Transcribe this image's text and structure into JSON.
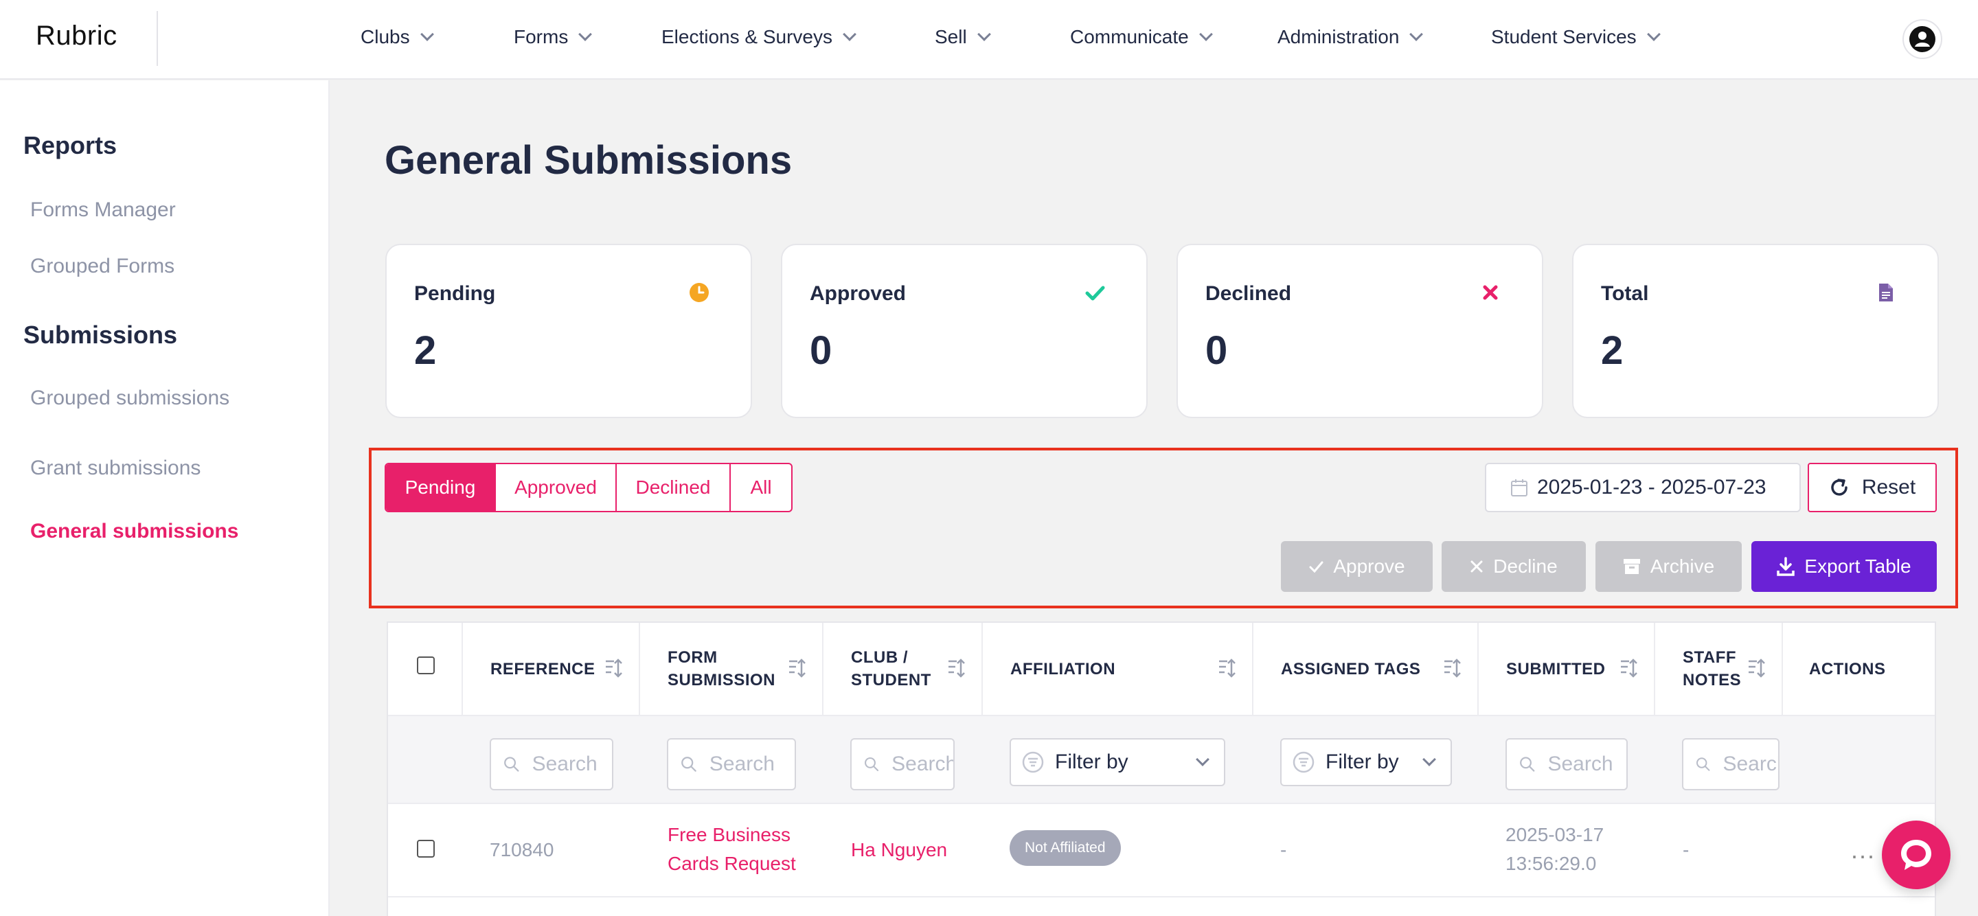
{
  "app": {
    "logo": "Rubric"
  },
  "nav": [
    {
      "label": "Clubs"
    },
    {
      "label": "Forms"
    },
    {
      "label": "Elections & Surveys"
    },
    {
      "label": "Sell"
    },
    {
      "label": "Communicate"
    },
    {
      "label": "Administration"
    },
    {
      "label": "Student Services"
    }
  ],
  "sidebar": {
    "reports_heading": "Reports",
    "reports_items": [
      {
        "label": "Forms Manager"
      },
      {
        "label": "Grouped Forms"
      }
    ],
    "submissions_heading": "Submissions",
    "submissions_items": [
      {
        "label": "Grouped submissions"
      },
      {
        "label": "Grant submissions"
      },
      {
        "label": "General submissions",
        "active": true
      }
    ]
  },
  "page": {
    "title": "General Submissions"
  },
  "stats": [
    {
      "label": "Pending",
      "value": "2",
      "icon": "clock-icon",
      "color": "#f5a623"
    },
    {
      "label": "Approved",
      "value": "0",
      "icon": "check-icon",
      "color": "#1ec99a"
    },
    {
      "label": "Declined",
      "value": "0",
      "icon": "x-icon",
      "color": "#e8206a"
    },
    {
      "label": "Total",
      "value": "2",
      "icon": "document-icon",
      "color": "#7b5ea7"
    }
  ],
  "filters": {
    "tabs": [
      {
        "label": "Pending",
        "active": true
      },
      {
        "label": "Approved"
      },
      {
        "label": "Declined"
      },
      {
        "label": "All"
      }
    ],
    "date_range": "2025-01-23 - 2025-07-23",
    "reset_label": "Reset"
  },
  "actions": {
    "approve_label": "Approve",
    "decline_label": "Decline",
    "archive_label": "Archive",
    "export_label": "Export Table"
  },
  "table": {
    "columns": {
      "reference": "REFERENCE",
      "form_submission": [
        "FORM",
        "SUBMISSION"
      ],
      "club_student": [
        "CLUB /",
        "STUDENT"
      ],
      "affiliation": "AFFILIATION",
      "assigned_tags": "ASSIGNED TAGS",
      "submitted": "SUBMITTED",
      "staff_notes": [
        "STAFF",
        "NOTES"
      ],
      "actions": "ACTIONS"
    },
    "search_placeholder": "Search",
    "filter_by": "Filter by",
    "rows": [
      {
        "reference": "710840",
        "form_submission": [
          "Free Business",
          "Cards Request"
        ],
        "club_student": "Ha Nguyen",
        "affiliation": "Not Affiliated",
        "assigned_tags": "-",
        "submitted": [
          "2025-03-17",
          "13:56:29.0"
        ],
        "staff_notes": "-",
        "actions": "..."
      }
    ]
  },
  "colors": {
    "accent": "#e8206a",
    "export": "#6a22d6",
    "highlight": "#e8321e"
  }
}
